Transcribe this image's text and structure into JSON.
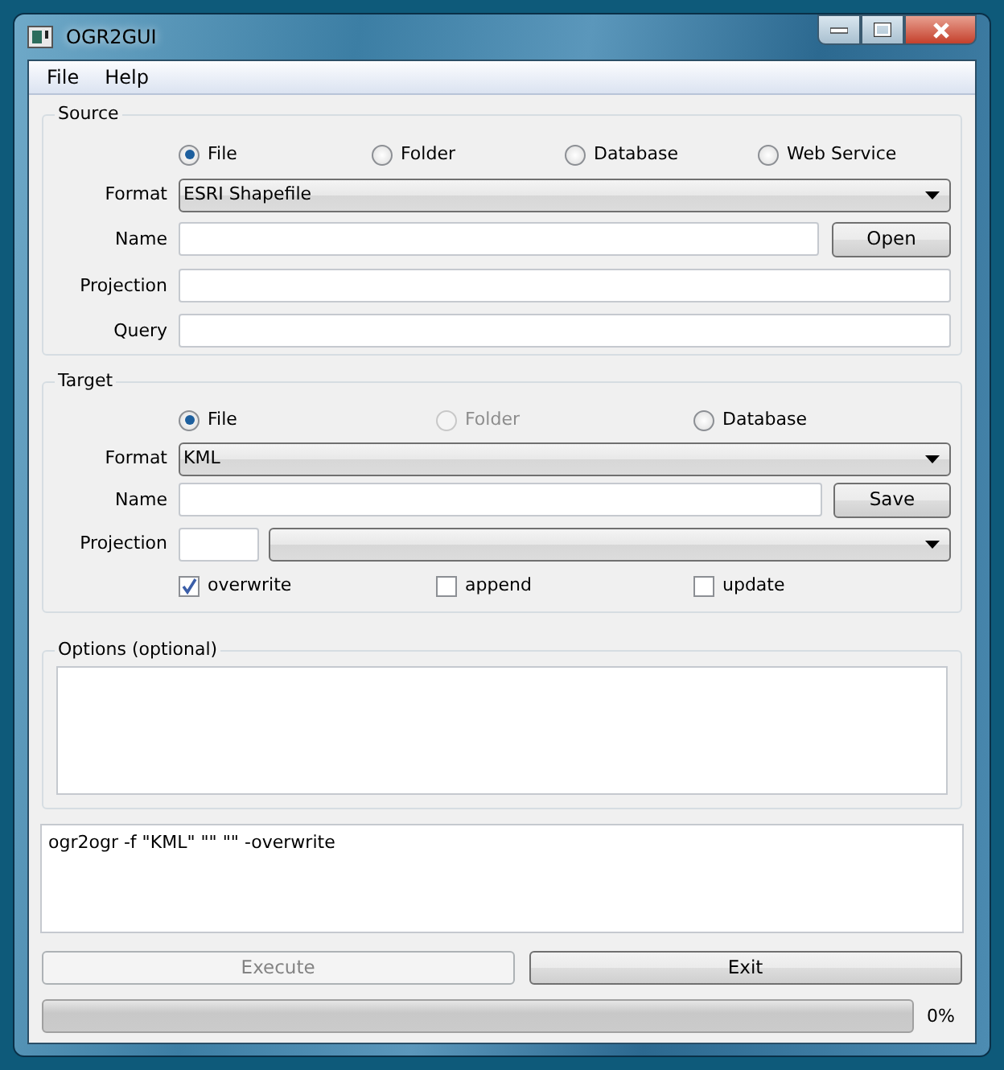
{
  "window": {
    "title": "OGR2GUI"
  },
  "menu": [
    "File",
    "Help"
  ],
  "source": {
    "title": "Source",
    "types": [
      {
        "label": "File",
        "selected": true
      },
      {
        "label": "Folder",
        "selected": false
      },
      {
        "label": "Database",
        "selected": false
      },
      {
        "label": "Web Service",
        "selected": false
      }
    ],
    "format": {
      "label": "Format",
      "value": "ESRI Shapefile"
    },
    "name": {
      "label": "Name",
      "button": "Open"
    },
    "projection": {
      "label": "Projection"
    },
    "query": {
      "label": "Query"
    }
  },
  "target": {
    "title": "Target",
    "types": [
      {
        "label": "File",
        "selected": true,
        "disabled": false
      },
      {
        "label": "Folder",
        "selected": false,
        "disabled": true
      },
      {
        "label": "Database",
        "selected": false,
        "disabled": false
      }
    ],
    "format": {
      "label": "Format",
      "value": "KML"
    },
    "name": {
      "label": "Name",
      "button": "Save"
    },
    "projection": {
      "label": "Projection"
    },
    "modes": [
      {
        "label": "overwrite",
        "checked": true
      },
      {
        "label": "append",
        "checked": false
      },
      {
        "label": "update",
        "checked": false
      }
    ]
  },
  "options": {
    "title": "Options (optional)"
  },
  "command": "ogr2ogr -f \"KML\" \"\" \"\" -overwrite",
  "buttons": [
    {
      "label": "Execute",
      "disabled": true
    },
    {
      "label": "Exit",
      "disabled": false
    }
  ],
  "progress": {
    "level": 0,
    "reading": "0%"
  }
}
